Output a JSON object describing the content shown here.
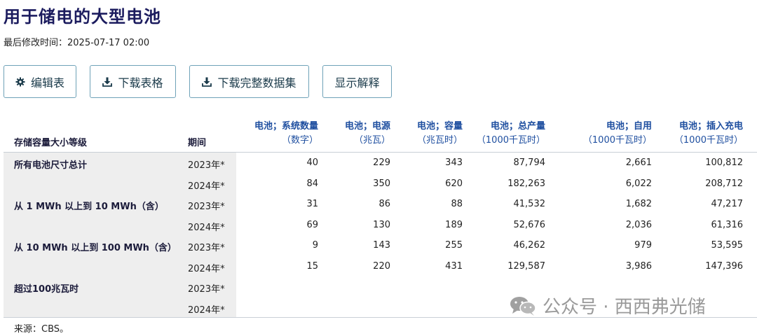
{
  "page": {
    "title": "用于储电的大型电池",
    "last_modified": "最后修改时间：2025-07-17 02:00"
  },
  "toolbar": {
    "edit_label": "编辑表",
    "download_table_label": "下载表格",
    "download_dataset_label": "下载完整数据集",
    "show_explanation_label": "显示解释"
  },
  "table": {
    "row_header": "存储容量大小等级",
    "period_header": "期间",
    "columns": [
      {
        "l1": "电池；系统数量",
        "l2": "（数字）"
      },
      {
        "l1": "电池；电源",
        "l2": "（兆瓦）"
      },
      {
        "l1": "电池；容量",
        "l2": "（兆瓦时）"
      },
      {
        "l1": "电池；总产量",
        "l2": "（1000千瓦时）"
      },
      {
        "l1": "电池；自用",
        "l2": "（1000千瓦时）"
      },
      {
        "l1": "电池；插入充电",
        "l2": "（1000千瓦时）"
      }
    ],
    "rows": [
      {
        "label": "所有电池尺寸总计",
        "period": "2023年*",
        "v": [
          "40",
          "229",
          "343",
          "87,794",
          "2,661",
          "100,812"
        ]
      },
      {
        "label": "",
        "period": "2024年*",
        "v": [
          "84",
          "350",
          "620",
          "182,263",
          "6,022",
          "208,712"
        ]
      },
      {
        "label": "从 1 MWh 以上到 10 MWh（含）",
        "period": "2023年*",
        "v": [
          "31",
          "86",
          "88",
          "41,532",
          "1,682",
          "47,217"
        ]
      },
      {
        "label": "",
        "period": "2024年*",
        "v": [
          "69",
          "130",
          "189",
          "52,676",
          "2,036",
          "61,316"
        ]
      },
      {
        "label": "从 10 MWh 以上到 100 MWh（含）",
        "period": "2023年*",
        "v": [
          "9",
          "143",
          "255",
          "46,262",
          "979",
          "53,595"
        ]
      },
      {
        "label": "",
        "period": "2024年*",
        "v": [
          "15",
          "220",
          "431",
          "129,587",
          "3,986",
          "147,396"
        ]
      },
      {
        "label": "超过100兆瓦时",
        "period": "2023年*",
        "v": [
          "",
          "",
          "",
          "",
          "",
          ""
        ]
      },
      {
        "label": "",
        "period": "2024年*",
        "v": [
          "",
          "",
          "",
          "",
          "",
          ""
        ]
      }
    ]
  },
  "footer": {
    "source": "来源：CBS。"
  },
  "watermark": {
    "text": "公众号 · 西西弗光储",
    "icon": "wechat-icon"
  }
}
